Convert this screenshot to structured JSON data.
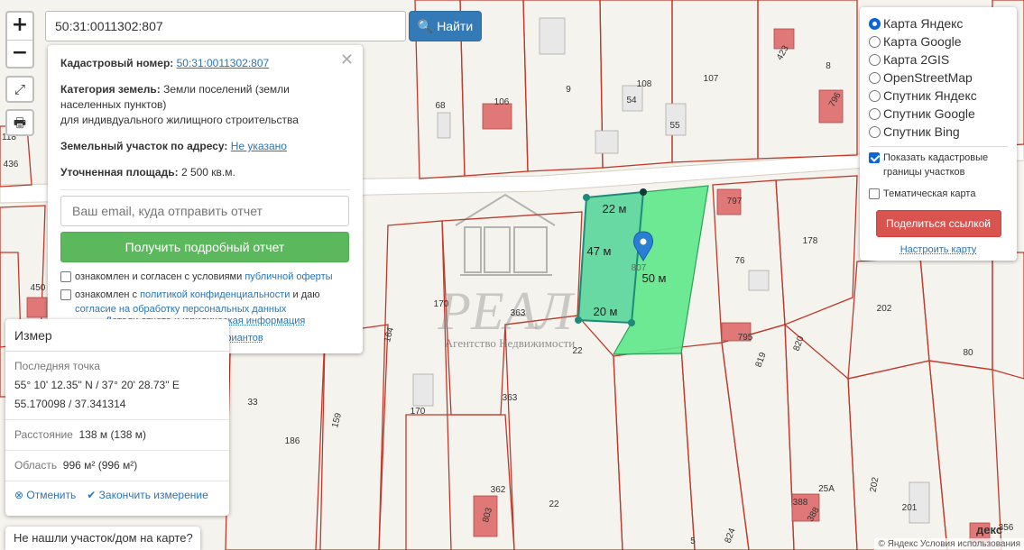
{
  "search": {
    "value": "50:31:0011302:807",
    "button_label": "Найти"
  },
  "zoom": {
    "in": "+",
    "out": "−"
  },
  "info": {
    "cadastral_label": "Кадастровый номер:",
    "cadastral_number": "50:31:0011302:807",
    "category_label": "Категория земель:",
    "category_value": "Земли поселений (земли населенных пунктов)",
    "category_use": "для индивдуального жилищного строительства",
    "address_label": "Земельный участок по адресу:",
    "address_value": "Не указано",
    "area_label": "Уточненная площадь:",
    "area_value": "2 500 кв.м.",
    "email_placeholder": "Ваш email, куда отправить отчет",
    "report_button": "Получить подробный отчет",
    "agree1_text": "ознакомлен и согласен с условиями",
    "agree1_link": "публичной оферты",
    "agree2_text": "ознакомлен с",
    "agree2_link": "политикой конфиденциальности",
    "agree2_mid": "и даю",
    "agree2_link2": "согласие на обработку персональных данных",
    "details_link": "Детали отчета и юридическая информация",
    "manual_link": "Ручной выбор вариантов"
  },
  "layers": {
    "options": [
      "Карта Яндекс",
      "Карта Google",
      "Карта 2GIS",
      "OpenStreetMap",
      "Спутник Яндекс",
      "Спутник Google",
      "Спутник Bing"
    ],
    "selected_index": 0,
    "show_borders": "Показать кадастровые границы участков",
    "show_borders_checked": true,
    "thematic": "Тематическая карта",
    "thematic_checked": false,
    "share_button": "Поделиться ссылкой",
    "configure_link": "Настроить карту"
  },
  "measure": {
    "title": "Измер",
    "last_point_label": "Последняя точка",
    "coords_dms": "55° 10' 12.35\" N / 37° 20' 28.73\" E",
    "coords_dec": "55.170098 / 37.341314",
    "distance_label": "Расстояние",
    "distance_value": "138 м (138 м)",
    "area_label": "Область",
    "area_value": "996 м² (996 м²)",
    "cancel": "Отменить",
    "finish": "Закончить измерение"
  },
  "notfound": "Не нашли участок/дом на карте?",
  "watermark": {
    "brand": "РЕАЛ",
    "tagline": "Агентство Недвижимости"
  },
  "measure_labels": {
    "top": "22 м",
    "left": "47 м",
    "bottom": "20 м",
    "right": "50 м",
    "pin": "807"
  },
  "plot_numbers": [
    "68",
    "106",
    "9",
    "108",
    "54",
    "55",
    "107",
    "423",
    "8",
    "796",
    "436",
    "118",
    "797",
    "178",
    "76",
    "202",
    "80",
    "795",
    "820",
    "819",
    "170",
    "363",
    "22",
    "164",
    "159",
    "33",
    "186",
    "450",
    "363",
    "170",
    "362",
    "22",
    "803",
    "388",
    "25А",
    "201",
    "388",
    "202",
    "356",
    "5",
    "824"
  ],
  "copyright": "© Яндекс  Условия использования",
  "ylogo": "декс",
  "colors": {
    "plot_fill": "#5ee88a",
    "plot_stroke": "#2ea05a",
    "measure_fill": "#4fd494",
    "measure_stroke": "#1f8a7a",
    "boundary": "#c0392b",
    "building": "#e07878",
    "pin": "#2a7fd4"
  }
}
